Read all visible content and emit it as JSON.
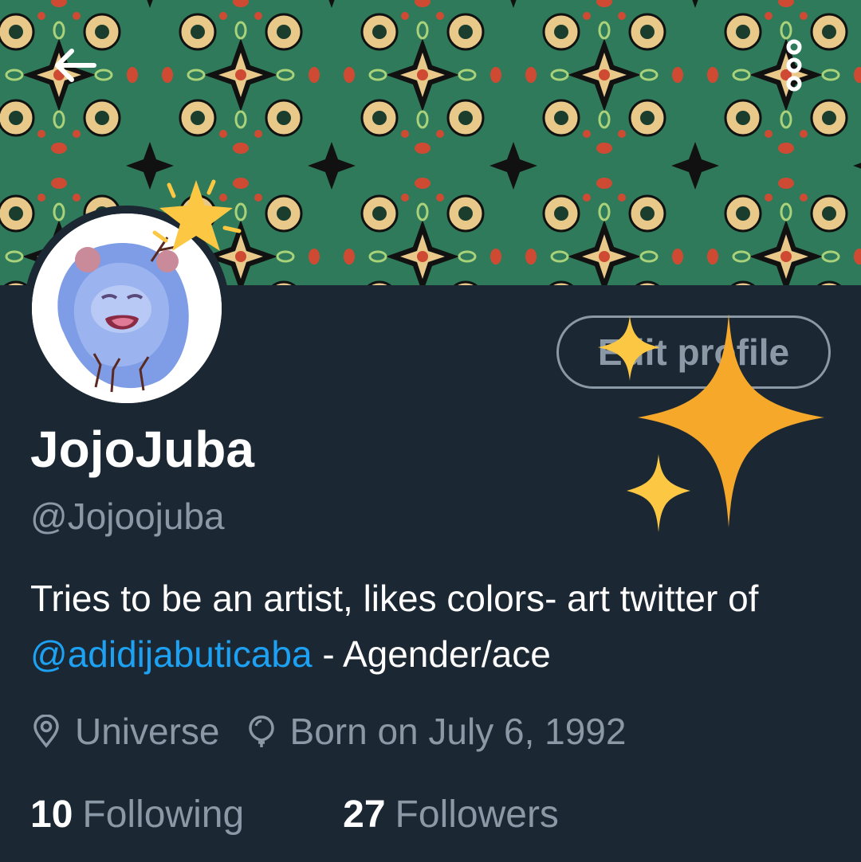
{
  "header": {
    "back_icon": "arrow-left-icon",
    "more_icon": "more-vertical-icon"
  },
  "profile": {
    "display_name": "JojoJuba",
    "handle": "@Jojoojuba",
    "edit_button_label": "Edit profile",
    "bio": {
      "text_before": "Tries to be an artist, likes colors- art twitter of ",
      "mention": "@adidijabuticaba",
      "text_after": " - Agender/ace"
    },
    "location": "Universe",
    "birthday": "Born on July 6, 1992",
    "following_count": "10",
    "following_label": "Following",
    "followers_count": "27",
    "followers_label": "Followers"
  },
  "colors": {
    "background": "#1b2733",
    "banner_green": "#2f7a5a",
    "banner_gold": "#e8c98a",
    "accent_blue": "#1da1f2",
    "muted_text": "#8b98a5",
    "sparkle_orange": "#f6a82a",
    "sparkle_yellow": "#fcc843"
  }
}
